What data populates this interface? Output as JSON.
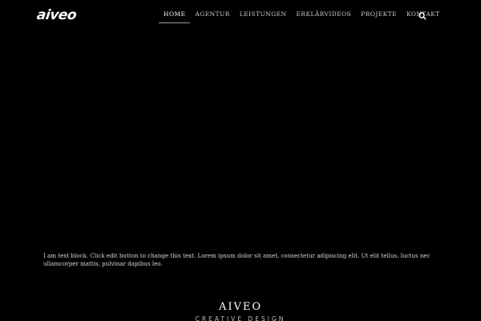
{
  "header": {
    "logo_text": "aiveo",
    "nav": [
      {
        "label": "HOME",
        "active": true
      },
      {
        "label": "AGENTUR",
        "active": false
      },
      {
        "label": "LEISTUNGEN",
        "active": false
      },
      {
        "label": "ERKLÄRVIDEOS",
        "active": false
      },
      {
        "label": "PROJEKTE",
        "active": false
      },
      {
        "label": "KONTAKT",
        "active": false
      }
    ],
    "search_icon": "search-icon"
  },
  "main": {
    "text_block": "I am text block. Click edit button to change this text. Lorem ipsum dolor sit amet, consectetur adipiscing elit. Ut elit tellus, luctus nec ullamcorper mattis, pulvinar dapibus leo."
  },
  "footer": {
    "brand_name": "AIVEO",
    "brand_tagline": "CREATIVE DESIGN"
  },
  "colors": {
    "background": "#000000",
    "text": "#d8d8d8",
    "nav_underline": "#9a9a9a"
  }
}
